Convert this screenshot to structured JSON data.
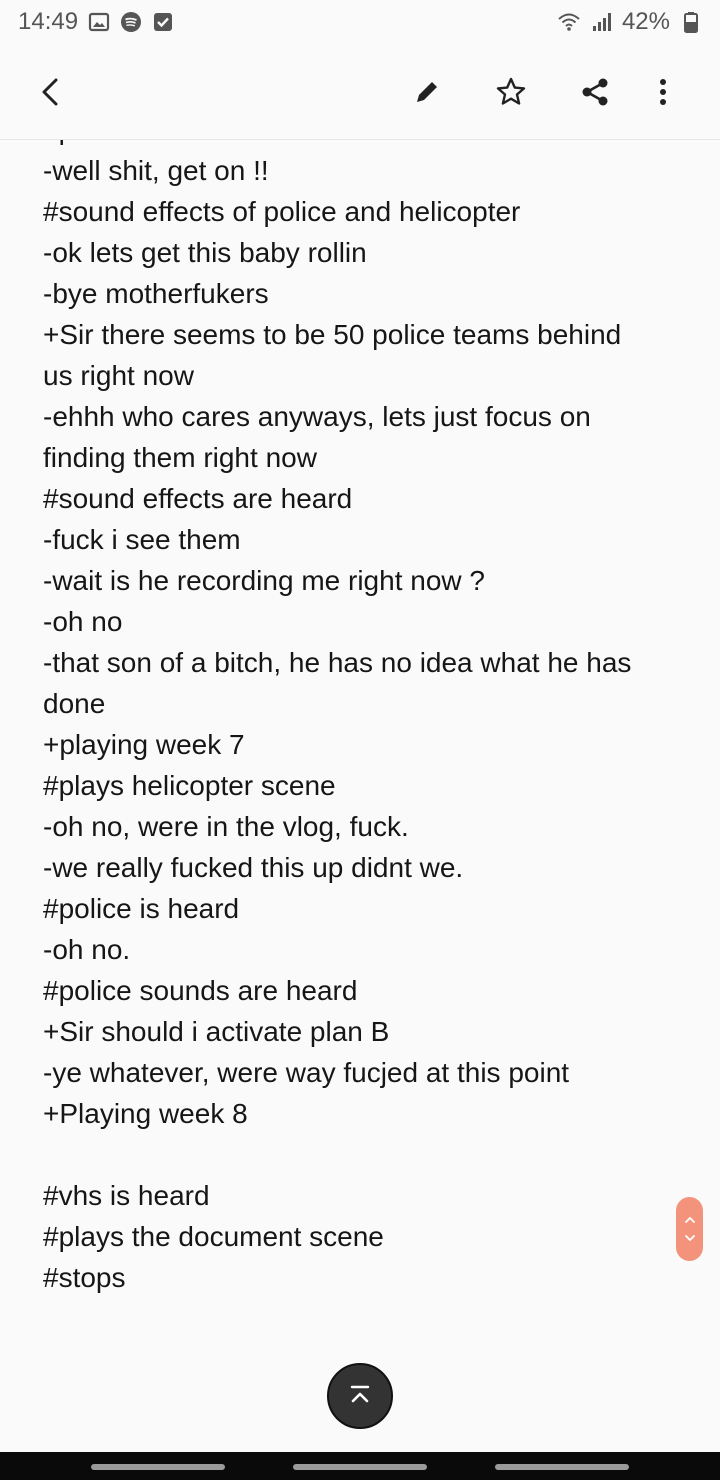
{
  "status_bar": {
    "time": "14:49",
    "battery": "42%",
    "icons_left": [
      "gallery-icon",
      "spotify-icon",
      "checkbox-icon"
    ],
    "icons_right": [
      "wifi-icon",
      "signal-icon",
      "battery-icon"
    ]
  },
  "app_bar": {
    "icons": [
      "back-icon",
      "edit-pencil-icon",
      "star-icon",
      "share-icon",
      "more-vert-icon"
    ]
  },
  "note": {
    "lines": [
      "#police is heard",
      "-well shit, get on !!",
      "#sound effects of police and helicopter",
      "-ok lets get this baby rollin",
      "-bye motherfukers",
      "+Sir there seems to be 50 police teams behind",
      "us right now",
      "-ehhh who cares anyways, lets just focus on",
      "finding them right now",
      "#sound effects are heard",
      "-fuck i see them",
      "-wait is he recording me right now ?",
      "-oh no",
      "-that son of a bitch, he has no idea what he has",
      "done",
      "+playing week 7",
      "#plays helicopter scene",
      "-oh no, were in the vlog, fuck.",
      "-we really fucked this up didnt we.",
      "#police is heard",
      "-oh no.",
      "#police sounds are heard",
      "+Sir should i activate plan B",
      "-ye whatever, were way fucjed at this point",
      "+Playing week 8",
      "",
      "#vhs is heard",
      "#plays the document scene",
      "#stops"
    ]
  },
  "colors": {
    "accent": "#f4937c",
    "fab": "#333333",
    "navbar": "#0a0a0a"
  }
}
